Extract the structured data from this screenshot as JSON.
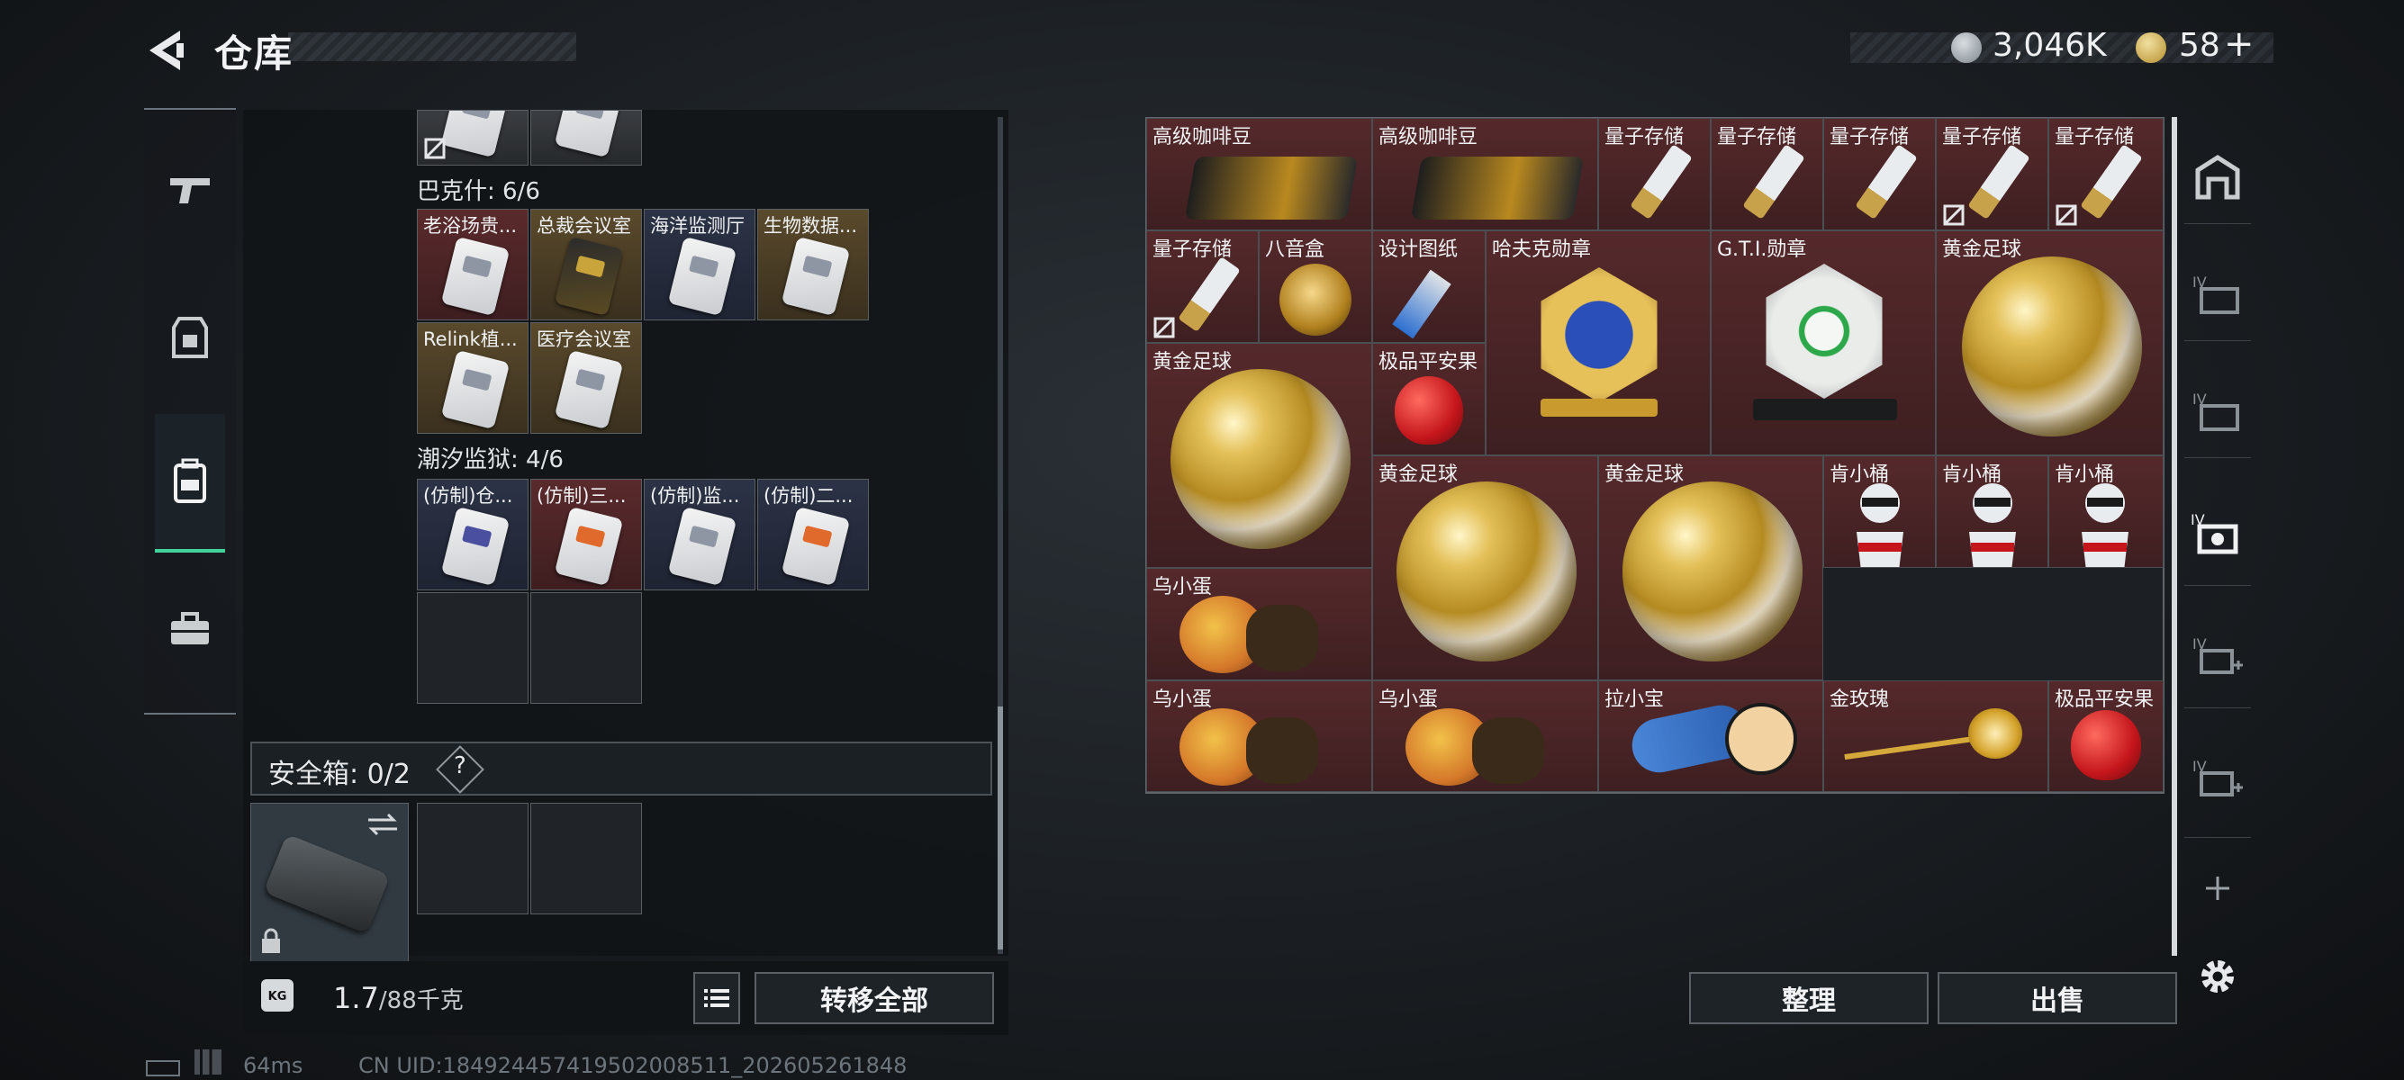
{
  "header": {
    "title": "仓库",
    "currency1": "3,046K",
    "currency2": "58",
    "plus": "+"
  },
  "left": {
    "groups": [
      {
        "title": "巴克什: 6/6",
        "items": [
          "老浴场贵...",
          "总裁会议室",
          "海洋监测厅",
          "生物数据...",
          "Relink植...",
          "医疗会议室"
        ]
      },
      {
        "title": "潮汐监狱: 4/6",
        "items": [
          "(仿制)仓...",
          "(仿制)三...",
          "(仿制)监...",
          "(仿制)二..."
        ]
      }
    ],
    "safe_box": "安全箱: 0/2",
    "help": "?",
    "weight_value": "1.7",
    "weight_total": "/88千克",
    "lock_label": "KG",
    "transfer_all": "转移全部"
  },
  "right": {
    "items": [
      {
        "label": "高级咖啡豆"
      },
      {
        "label": "高级咖啡豆"
      },
      {
        "label": "量子存储"
      },
      {
        "label": "量子存储"
      },
      {
        "label": "量子存储"
      },
      {
        "label": "量子存储"
      },
      {
        "label": "量子存储"
      },
      {
        "label": "量子存储"
      },
      {
        "label": "八音盒"
      },
      {
        "label": "设计图纸"
      },
      {
        "label": "哈夫克勋章"
      },
      {
        "label": "G.T.I.勋章"
      },
      {
        "label": "黄金足球"
      },
      {
        "label": "黄金足球"
      },
      {
        "label": "极品平安果"
      },
      {
        "label": "黄金足球"
      },
      {
        "label": "黄金足球"
      },
      {
        "label": "肯小桶"
      },
      {
        "label": "肯小桶"
      },
      {
        "label": "肯小桶"
      },
      {
        "label": "乌小蛋"
      },
      {
        "label": "乌小蛋"
      },
      {
        "label": "乌小蛋"
      },
      {
        "label": "拉小宝"
      },
      {
        "label": "金玫瑰"
      },
      {
        "label": "极品平安果"
      }
    ],
    "sort": "整理",
    "sell": "出售"
  },
  "hud": {
    "ping": "64ms",
    "uid": "CN UID:184924457419502008511_202605261848"
  },
  "colors": {
    "accent": "#44d29b"
  }
}
